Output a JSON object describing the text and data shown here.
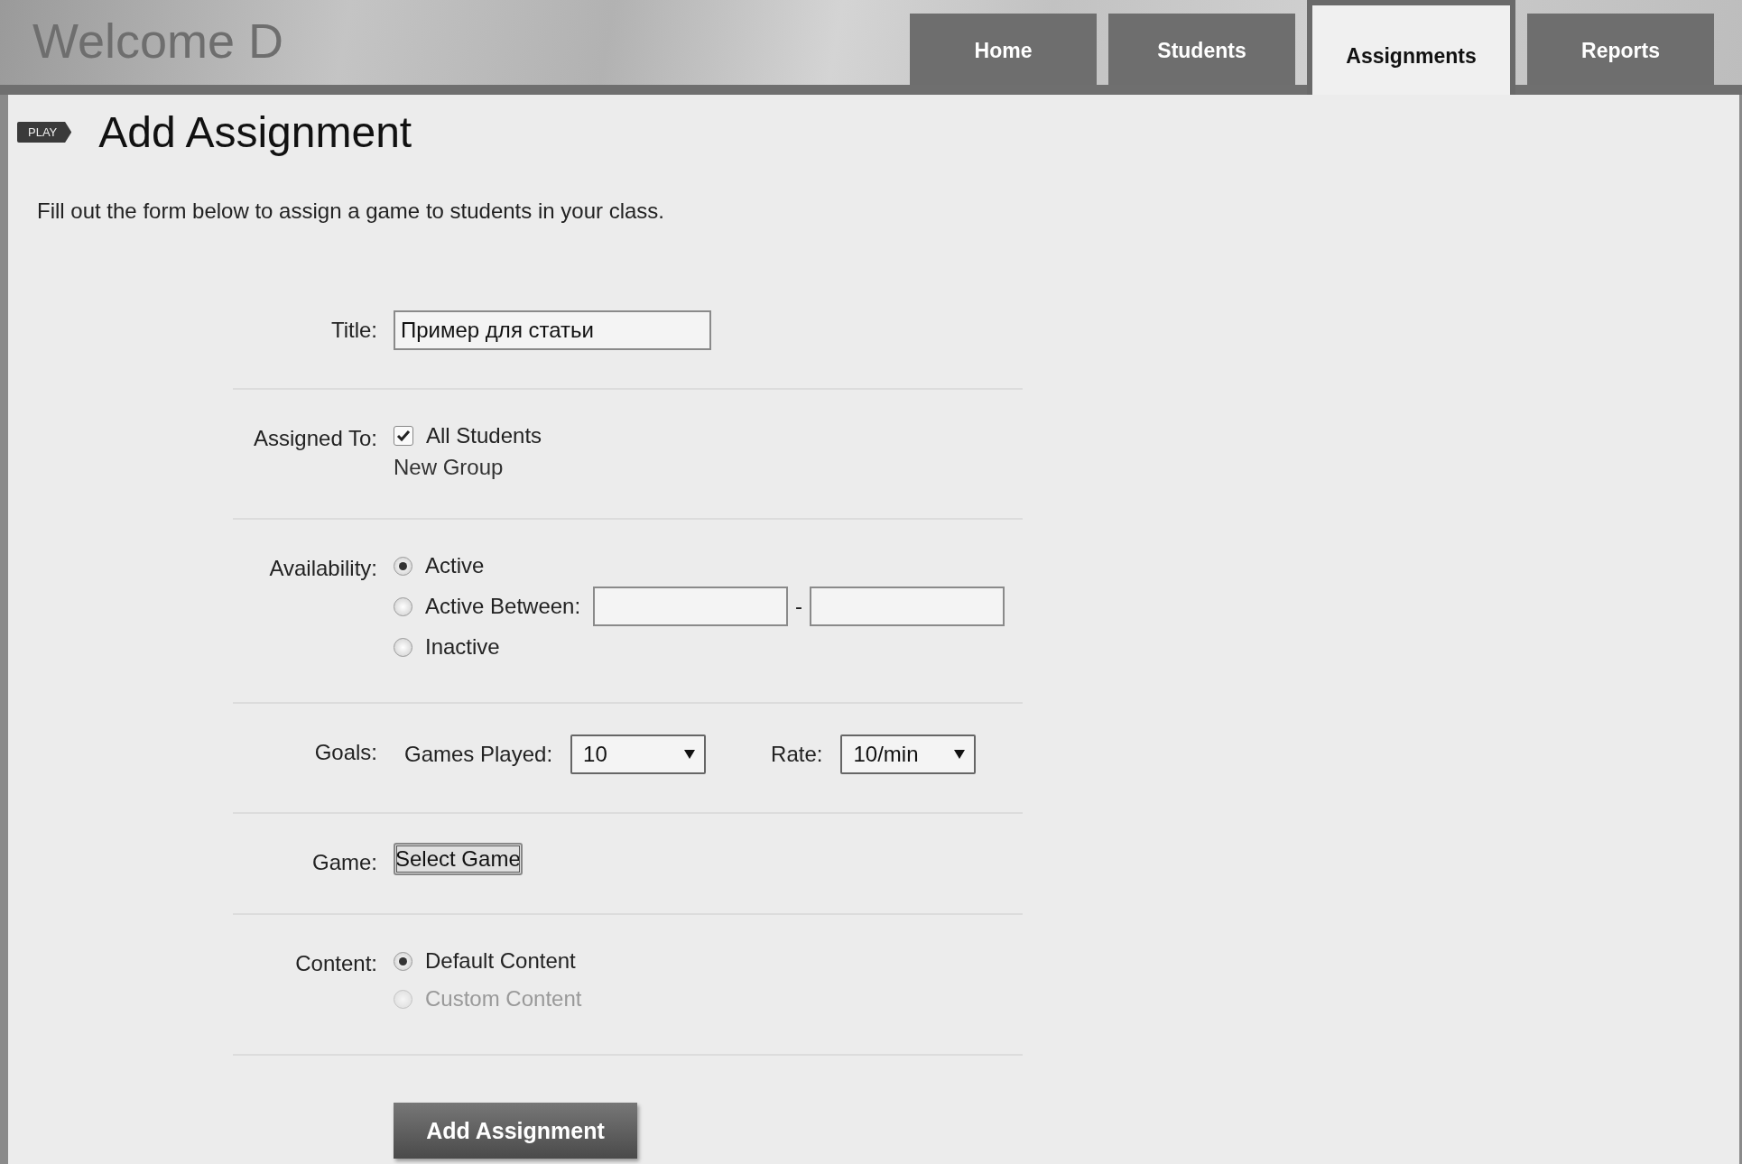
{
  "header": {
    "welcome": "Welcome D"
  },
  "tabs": [
    {
      "label": "Home",
      "selected": false
    },
    {
      "label": "Students",
      "selected": false
    },
    {
      "label": "Assignments",
      "selected": true
    },
    {
      "label": "Reports",
      "selected": false
    }
  ],
  "page": {
    "badge": "PLAY",
    "title": "Add Assignment",
    "intro": "Fill out the form below to assign a game to students in your class."
  },
  "form": {
    "rows": [
      {
        "kind": "text",
        "label": "Title:",
        "value": "Пример для статьи"
      },
      {
        "kind": "checklist",
        "label": "Assigned To:",
        "options": [
          {
            "label": "All Students",
            "checked": true
          }
        ],
        "note": "New Group"
      },
      {
        "kind": "radios",
        "label": "Availability:",
        "options": [
          {
            "label": "Active",
            "selected": true,
            "disabled": false
          },
          {
            "label": "Active Between:",
            "selected": false,
            "disabled": false,
            "separator": "-"
          },
          {
            "label": "Inactive",
            "selected": false,
            "disabled": false
          }
        ]
      },
      {
        "kind": "selects",
        "label": "Goals:",
        "selects": [
          {
            "label": "Games Played:",
            "value": "10"
          },
          {
            "label": "Rate:",
            "value": "10/min"
          }
        ]
      },
      {
        "kind": "button",
        "label": "Game:",
        "button": "Select Game"
      },
      {
        "kind": "radios",
        "label": "Content:",
        "options": [
          {
            "label": "Default Content",
            "selected": true,
            "disabled": false
          },
          {
            "label": "Custom Content",
            "selected": false,
            "disabled": true
          }
        ]
      }
    ],
    "submit": "Add Assignment"
  }
}
